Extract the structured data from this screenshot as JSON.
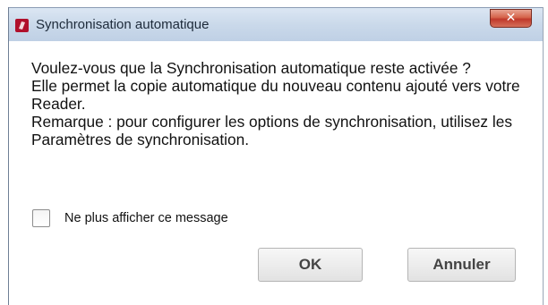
{
  "window": {
    "title": "Synchronisation automatique",
    "close_symbol": "✕",
    "titlebar_color": "#c8d8ea",
    "close_color": "#c9432f",
    "app_icon": "red-app-icon"
  },
  "message": {
    "lines": [
      "Voulez-vous que la Synchronisation automatique reste activée ?",
      "Elle permet la copie automatique du nouveau contenu ajouté vers votre Reader.",
      "Remarque : pour configurer les options de synchronisation, utilisez les Paramètres de synchronisation."
    ]
  },
  "checkbox": {
    "label": "Ne plus afficher ce message",
    "checked": false
  },
  "buttons": {
    "ok_label": "OK",
    "cancel_label": "Annuler"
  }
}
